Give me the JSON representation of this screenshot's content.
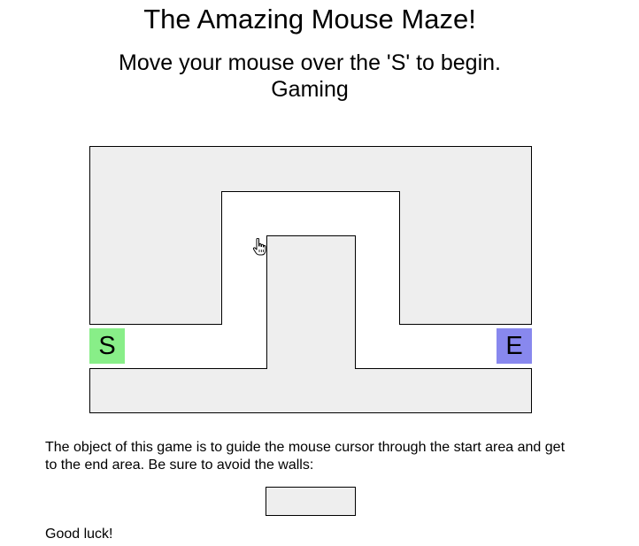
{
  "title": "The Amazing Mouse Maze!",
  "instruction": "Move your mouse over the 'S' to begin.",
  "status": "Gaming",
  "maze": {
    "start_label": "S",
    "end_label": "E",
    "start_color": "#88ee88",
    "end_color": "#8888ee",
    "wall_color": "#eeeeee"
  },
  "description": "The object of this game is to guide the mouse cursor through the start area and get to the end area. Be sure to avoid the walls:",
  "closing": "Good luck!"
}
